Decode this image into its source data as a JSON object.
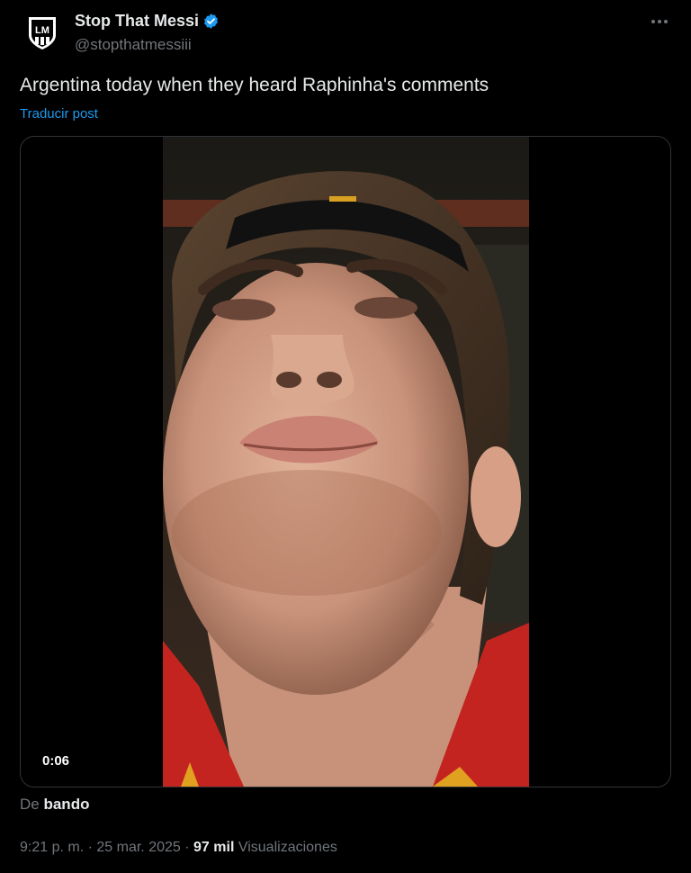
{
  "author": {
    "display_name": "Stop That Messi",
    "handle": "@stopthatmessiii",
    "avatar_monogram": "LM",
    "verified": true
  },
  "post": {
    "text": "Argentina today when they heard Raphinha's comments",
    "translate_label": "Traducir post"
  },
  "media": {
    "type": "video",
    "duration": "0:06",
    "description_icon": "video-player"
  },
  "source": {
    "prefix": "De",
    "name": "bando"
  },
  "meta": {
    "time": "9:21 p. m.",
    "separator": "·",
    "date": "25 mar. 2025",
    "views_count": "97 mil",
    "views_label": "Visualizaciones"
  },
  "colors": {
    "background": "#000000",
    "text_primary": "#e7e9ea",
    "text_secondary": "#71767b",
    "link": "#1d9bf0",
    "verified": "#1d9bf0",
    "border": "#2f3336"
  },
  "icons": {
    "more": "more-dots-icon",
    "verified": "verified-badge-icon"
  }
}
